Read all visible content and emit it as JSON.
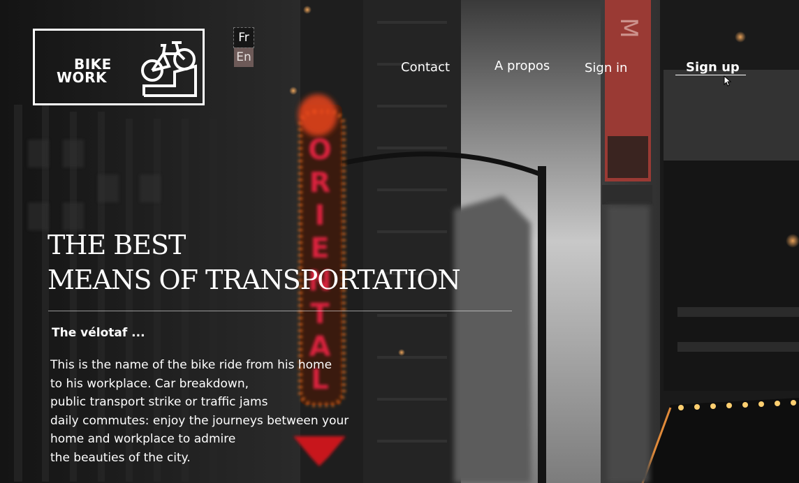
{
  "logo": {
    "line1": "BIKE",
    "line2": "WORK"
  },
  "language": {
    "options": [
      "Fr",
      "En"
    ],
    "selected": "En"
  },
  "nav": {
    "contact": "Contact",
    "about": "A propos",
    "signin": "Sign in",
    "signup": "Sign up"
  },
  "hero": {
    "title_line1": "THE BEST",
    "title_line2": "MEANS OF TRANSPORTATION",
    "subtitle": "The vélotaf ...",
    "body_lines": [
      "This is the name of the bike ride from his home",
      "to his workplace. Car breakdown,",
      "public transport strike or traffic jams",
      "daily commutes: enjoy the journeys between your",
      "home and workplace to admire",
      "the beauties of the city."
    ]
  },
  "background": {
    "sign_vertical": "ORIENTAL",
    "banner_letters": "MARQ"
  },
  "colors": {
    "neon": "#e8441b",
    "neon_red": "#d9203c",
    "lang_active": "#6d5a58",
    "banner": "#9a3a34"
  }
}
